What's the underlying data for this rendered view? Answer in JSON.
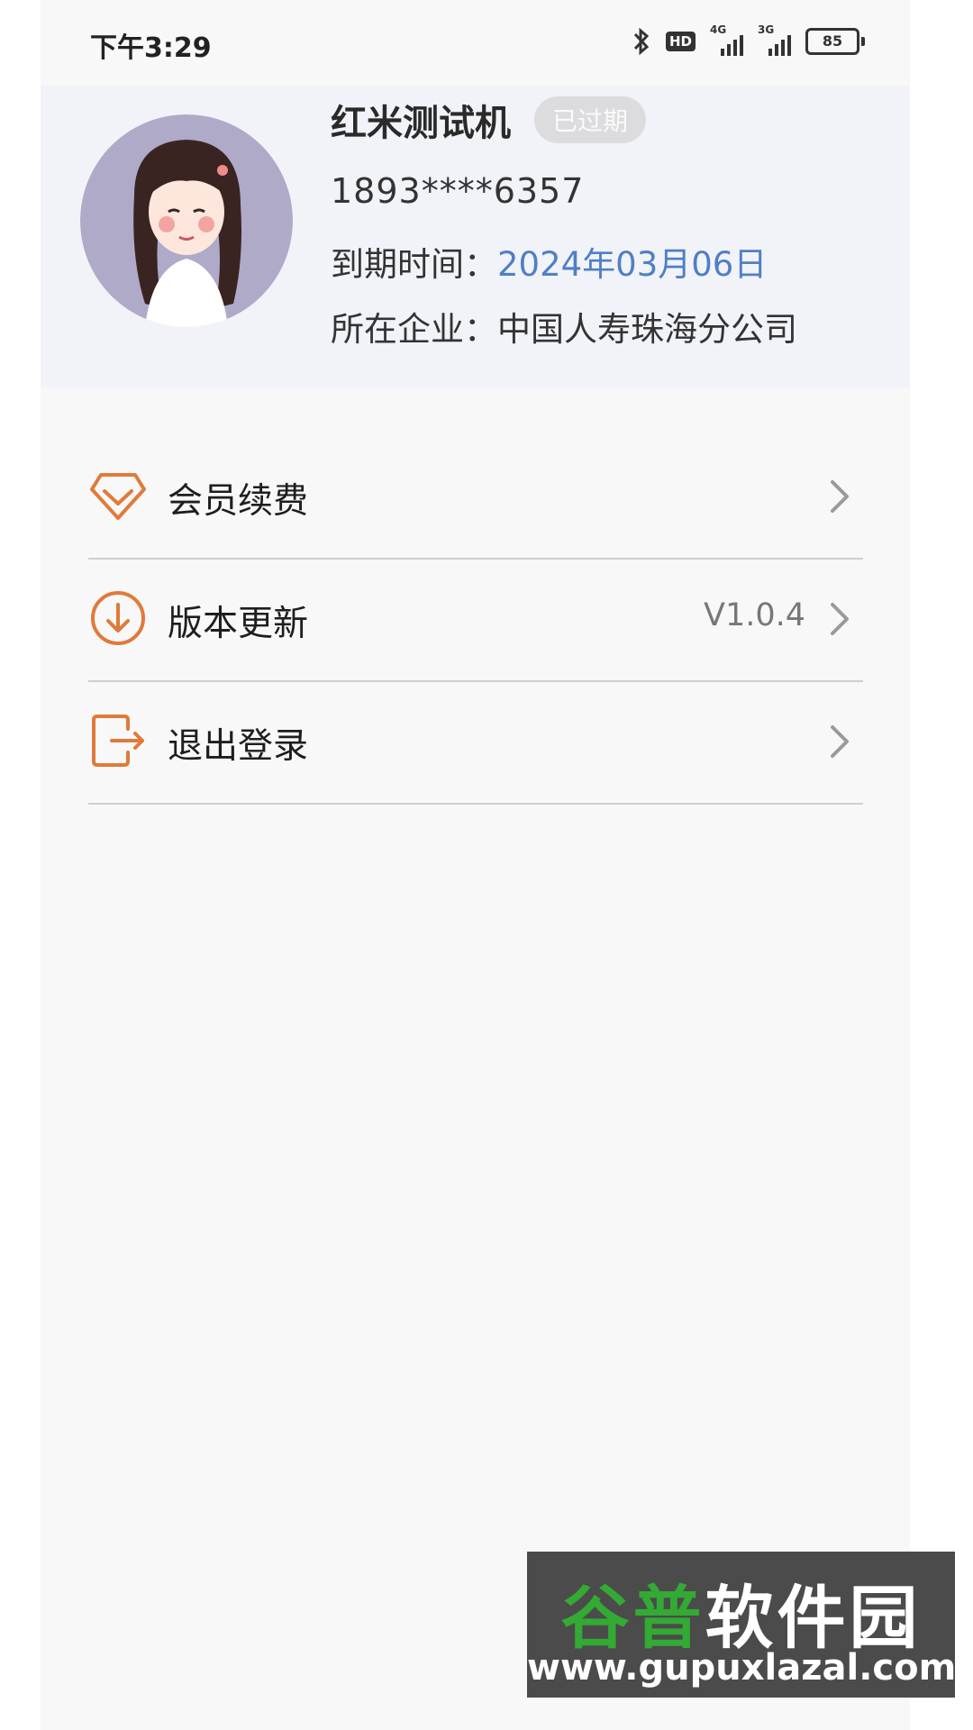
{
  "status_bar": {
    "time": "下午3:29",
    "hd_label": "HD",
    "network_1": "4G",
    "network_2": "3G",
    "battery_level": "85"
  },
  "profile": {
    "name": "红米测试机",
    "status_badge": "已过期",
    "phone": "1893****6357",
    "expiry_label": "到期时间：",
    "expiry_value": "2024年03月06日",
    "company_label": "所在企业：",
    "company_value": "中国人寿珠海分公司"
  },
  "menu": [
    {
      "label": "会员续费",
      "value": "",
      "icon": "diamond-icon"
    },
    {
      "label": "版本更新",
      "value": "V1.0.4",
      "icon": "download-icon"
    },
    {
      "label": "退出登录",
      "value": "",
      "icon": "logout-icon"
    }
  ],
  "watermark": {
    "logo_part1": "谷普",
    "logo_part2": "软件园",
    "url": "www.gupuxlazal.com"
  },
  "colors": {
    "accent": "#e07a3a",
    "expiry": "#4f7fc6",
    "badge_bg": "#dcdcdf"
  }
}
